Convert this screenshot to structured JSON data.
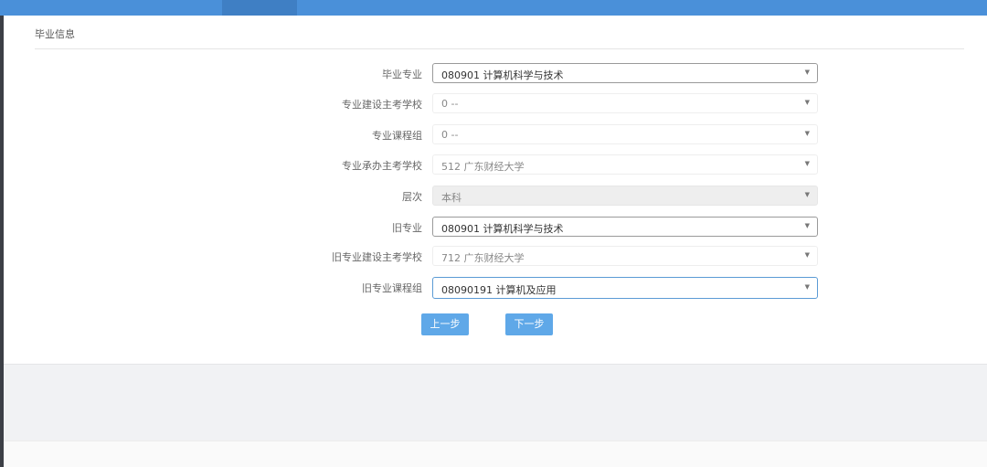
{
  "section": {
    "title": "毕业信息"
  },
  "form": {
    "fields": [
      {
        "label": "毕业专业",
        "value": "080901 计算机科学与技术"
      },
      {
        "label": "专业建设主考学校",
        "value": "0 --"
      },
      {
        "label": "专业课程组",
        "value": "0 --"
      },
      {
        "label": "专业承办主考学校",
        "value": "512 广东财经大学"
      },
      {
        "label": "层次",
        "value": "本科"
      },
      {
        "label": "旧专业",
        "value": "080901 计算机科学与技术"
      },
      {
        "label": "旧专业建设主考学校",
        "value": "712 广东财经大学"
      },
      {
        "label": "旧专业课程组",
        "value": "08090191 计算机及应用"
      }
    ],
    "caret_glyph": "▼"
  },
  "buttons": {
    "prev_label": "上一步",
    "next_label": "下一步"
  },
  "colors": {
    "topbar": "#4a90d9",
    "button": "#5fa8e8"
  }
}
